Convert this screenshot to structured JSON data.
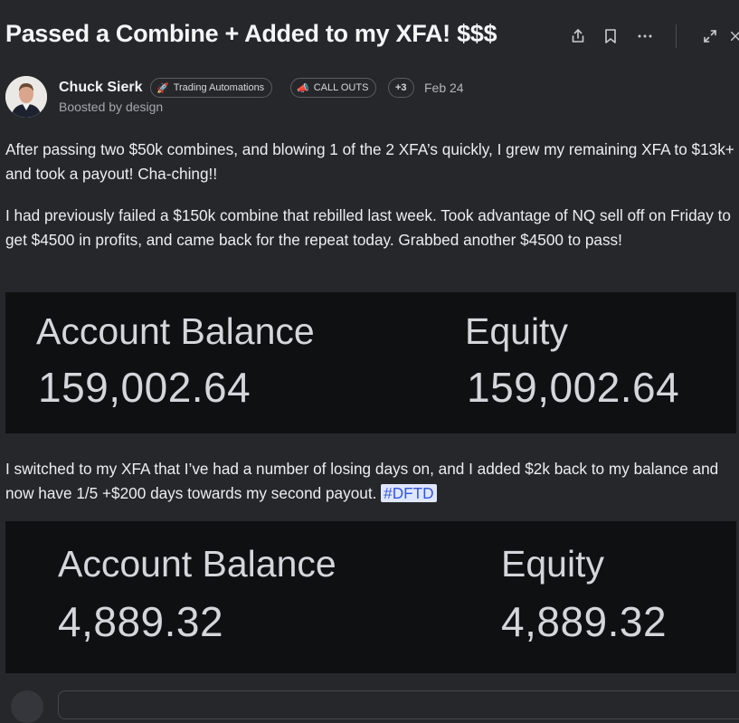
{
  "post": {
    "title": "Passed a Combine + Added to my XFA! $$$",
    "author": {
      "name": "Chuck Sierk",
      "boosted": "Boosted by design"
    },
    "badges": [
      {
        "icon": "rocket-icon",
        "label": "Trading Automations"
      },
      {
        "icon": "megaphone-icon",
        "label": "CALL OUTS"
      },
      {
        "label": "+3"
      }
    ],
    "date": "Feb 24",
    "paragraphs": [
      "After passing two $50k combines, and blowing 1 of the 2 XFA’s quickly, I grew my remaining XFA to $13k+ and took a payout! Cha-ching!!",
      "I had previously failed a $150k combine that rebilled last week. Took advantage of NQ sell off on Friday to get $4500 in profits, and came back for the repeat today. Grabbed another $4500 to pass!",
      "I switched to my XFA that I’ve had a number of losing days on, and I added $2k back to my balance and now have 1/5 +$200 days towards my second payout. "
    ],
    "hashtag": "#DFTD",
    "images": [
      {
        "account_balance_label": "Account Balance",
        "account_balance_value": "159,002.64",
        "equity_label": "Equity",
        "equity_value": "159,002.64"
      },
      {
        "account_balance_label": "Account Balance",
        "account_balance_value": "4,889.32",
        "equity_label": "Equity",
        "equity_value": "4,889.32"
      }
    ]
  },
  "toolbar": {
    "icons": [
      "share-icon",
      "bookmark-icon",
      "more-icon",
      "expand-icon",
      "close-icon"
    ]
  },
  "colors": {
    "background": "#25272b",
    "image_background": "#0f1012",
    "hashtag_bg": "#dfe6ff",
    "hashtag_text": "#3357d6"
  }
}
